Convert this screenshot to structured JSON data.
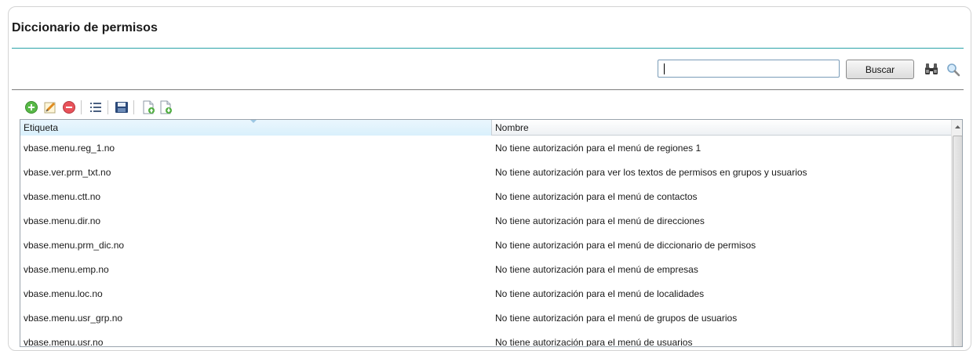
{
  "page": {
    "title": "Diccionario de permisos"
  },
  "search": {
    "value": "",
    "button_label": "Buscar"
  },
  "toolbar": {
    "icons": [
      "add-icon",
      "edit-icon",
      "delete-icon",
      "list-icon",
      "save-icon",
      "import-icon",
      "export-icon"
    ]
  },
  "table": {
    "columns": [
      "Etiqueta",
      "Nombre"
    ],
    "rows": [
      {
        "etiqueta": "vbase.menu.reg_1.no",
        "nombre": "No tiene autorización para el menú de regiones 1"
      },
      {
        "etiqueta": "vbase.ver.prm_txt.no",
        "nombre": "No tiene autorización para ver los textos de permisos en grupos y usuarios"
      },
      {
        "etiqueta": "vbase.menu.ctt.no",
        "nombre": "No tiene autorización para el menú de contactos"
      },
      {
        "etiqueta": "vbase.menu.dir.no",
        "nombre": "No tiene autorización para el menú de direcciones"
      },
      {
        "etiqueta": "vbase.menu.prm_dic.no",
        "nombre": "No tiene autorización para el menú de diccionario de permisos"
      },
      {
        "etiqueta": "vbase.menu.emp.no",
        "nombre": "No tiene autorización para el menú de empresas"
      },
      {
        "etiqueta": "vbase.menu.loc.no",
        "nombre": "No tiene autorización para el menú de localidades"
      },
      {
        "etiqueta": "vbase.menu.usr_grp.no",
        "nombre": "No tiene autorización para el menú de grupos de usuarios"
      },
      {
        "etiqueta": "vbase.menu.usr.no",
        "nombre": "No tiene autorización para el menú de usuarios"
      }
    ]
  },
  "colors": {
    "accent": "#2aa3a8",
    "header_selected": "#d9f0fc"
  }
}
